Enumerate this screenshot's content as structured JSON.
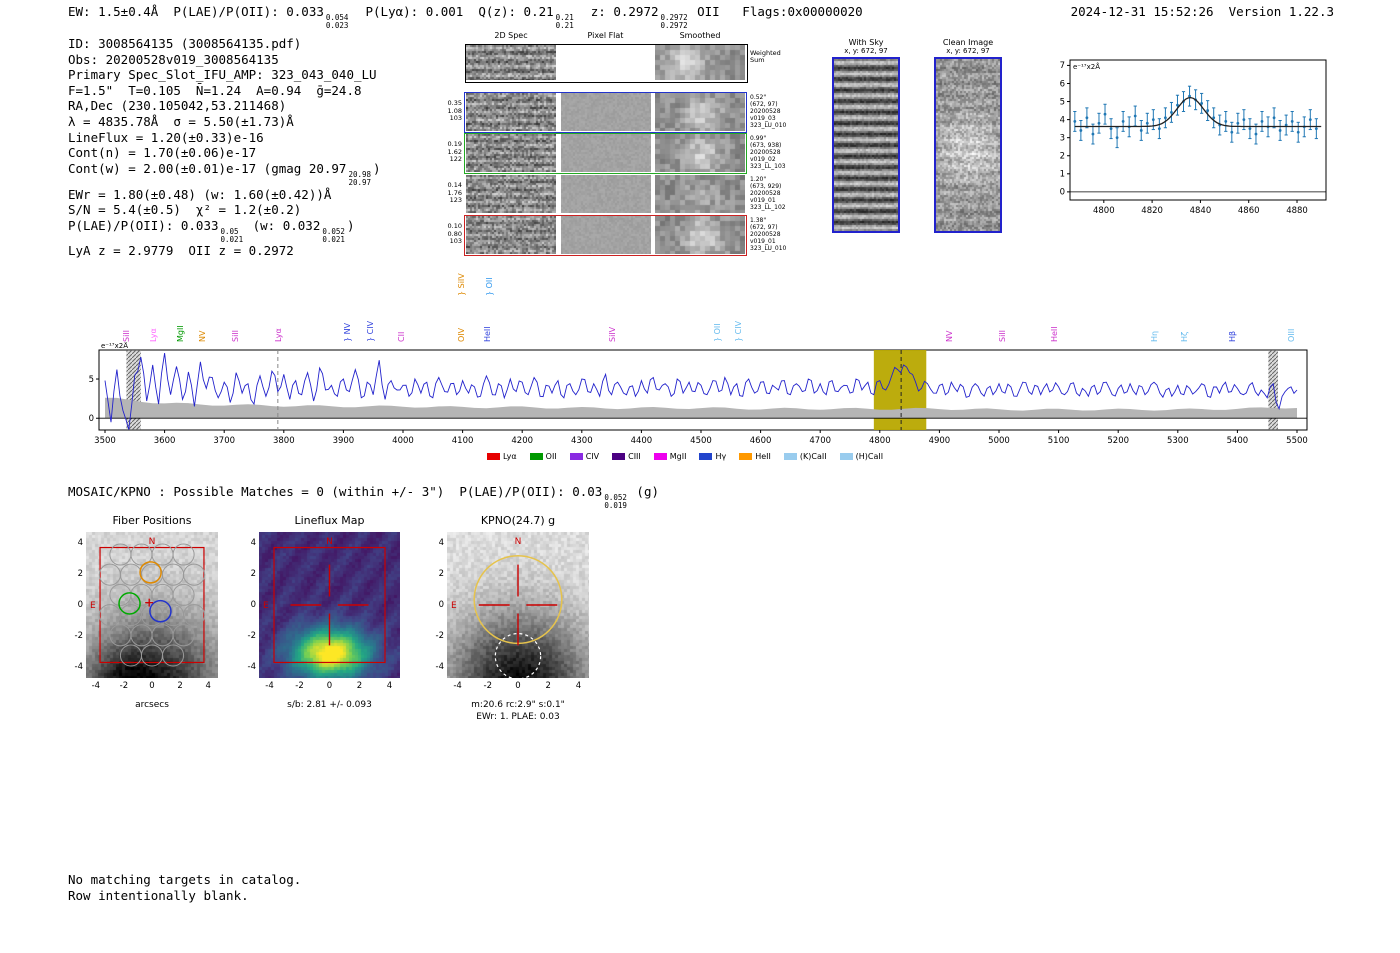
{
  "header": {
    "segments": [
      {
        "t": "EW: 1.5±0.4Å  P(LAE)/P(OII): 0.033"
      },
      {
        "sup": "0.054",
        "sub": "0.023"
      },
      {
        "t": "  P(Lyα): 0.001  Q(z): 0.21"
      },
      {
        "sup": "0.21",
        "sub": "0.21"
      },
      {
        "t": "  z: 0.2972"
      },
      {
        "sup": "0.2972",
        "sub": "0.2972"
      },
      {
        "t": " OII   Flags:0x00000020"
      }
    ],
    "datetime": "2024-12-31 15:52:26",
    "version": "Version 1.22.3"
  },
  "info": {
    "lines": [
      [
        {
          "t": "ID: 3008564135 (3008564135.pdf)"
        }
      ],
      [
        {
          "t": "Obs: 20200528v019_3008564135"
        }
      ],
      [
        {
          "t": "Primary Spec_Slot_IFU_AMP: 323_043_040_LU"
        }
      ],
      [
        {
          "t": "F=1.5\"  T=0.105  N̄=1.24  A=0.94  ḡ=24.8"
        }
      ],
      [
        {
          "t": "RA,Dec (230.105042,53.211468)"
        }
      ],
      [
        {
          "t": "λ = 4835.78Å  σ = 5.50(±1.73)Å"
        }
      ],
      [
        {
          "t": "LineFlux = 1.20(±0.33)e-16"
        }
      ],
      [
        {
          "t": "Cont(n) = 1.70(±0.06)e-17"
        }
      ],
      [
        {
          "t": "Cont(w) = 2.00(±0.01)e-17 (gmag 20.97"
        },
        {
          "sup": "20.98",
          "sub": "20.97"
        },
        {
          "t": ")"
        }
      ],
      [
        {
          "t": "EWr = 1.80(±0.48) (w: 1.60(±0.42))Å"
        }
      ],
      [
        {
          "t": "S/N = 5.4(±0.5)  χ² = 1.2(±0.2)"
        }
      ],
      [
        {
          "t": "P(LAE)/P(OII): 0.033"
        },
        {
          "sup": "0.05",
          "sub": "0.021"
        },
        {
          "t": " (w: 0.032"
        },
        {
          "sup": "0.052",
          "sub": "0.021"
        },
        {
          "t": ")"
        }
      ],
      [
        {
          "t": "LyA z = 2.9779  OII z = 0.2972"
        }
      ]
    ]
  },
  "cutouts": {
    "col_titles": [
      "2D Spec",
      "Pixel Flat",
      "Smoothed"
    ],
    "weighted_label": "Weighted\nSum",
    "rows": [
      {
        "left": "0.35\n1.08\n103",
        "right": "0.52\"\n(672, 97)\n20200528\nv019_03\n323_LU_010",
        "border": "#2233cc"
      },
      {
        "left": "0.19\n1.62\n122",
        "right": "0.99\"\n(673, 938)\n20200528\nv019_02\n323_LL_103",
        "border": "#22aa22"
      },
      {
        "left": "0.14\n1.76\n123",
        "right": "1.20\"\n(673, 929)\n20200528\nv019_01\n323_LL_102",
        "border": null
      },
      {
        "left": "0.10\n0.80\n103",
        "right": "1.38\"\n(672, 97)\n20200528\nv019_01\n323_LU_010",
        "border": "#cc2222"
      }
    ]
  },
  "sky": {
    "with_sky": {
      "title": "With Sky",
      "xy": "x, y: 672, 97"
    },
    "clean": {
      "title": "Clean Image",
      "xy": "x, y: 672, 97"
    }
  },
  "mosaic": {
    "segments": [
      {
        "t": "MOSAIC/KPNO : Possible Matches = 0 (within +/- 3\")  P(LAE)/P(OII): 0.03"
      },
      {
        "sup": "0.052",
        "sub": "0.019"
      },
      {
        "t": " (g)"
      }
    ]
  },
  "panels": {
    "axis_ticks": [
      -4,
      -2,
      0,
      2,
      4
    ],
    "fiber": {
      "title": "Fiber Positions",
      "xlabel": "arcsecs",
      "compass_n": "N",
      "compass_e": "E"
    },
    "lineflux": {
      "title": "Lineflux Map",
      "caption": "s/b: 2.81 +/- 0.093",
      "compass_n": "N",
      "compass_e": "E"
    },
    "kpno": {
      "title": "KPNO(24.7) g",
      "caption": "m:20.6 rc:2.9\" s:0.1\"",
      "caption2": "EWr: 1. PLAE: 0.03",
      "compass_n": "N",
      "compass_e": "E"
    }
  },
  "footer": {
    "lines": [
      "No matching targets in catalog.",
      "Row intentionally blank."
    ]
  },
  "chart_data": [
    {
      "type": "line",
      "name": "emission-line-fit",
      "ylabel": "e⁻¹⁷x2Å",
      "x_start": 4788,
      "x_step": 2.5,
      "y": [
        3.9,
        3.4,
        4.1,
        3.2,
        3.8,
        4.3,
        3.5,
        3.0,
        3.9,
        3.6,
        4.2,
        3.4,
        3.8,
        4.0,
        3.5,
        4.1,
        4.4,
        4.8,
        5.0,
        5.3,
        5.1,
        4.9,
        4.5,
        4.1,
        3.7,
        3.9,
        3.3,
        3.8,
        4.0,
        3.5,
        3.2,
        3.9,
        3.6,
        4.1,
        3.4,
        3.7,
        3.9,
        3.3,
        3.6,
        4.0,
        3.5
      ],
      "yerr": 0.55,
      "fit": {
        "mu": 4835.78,
        "sigma": 5.5,
        "amp": 1.6,
        "continuum": 3.62
      },
      "xlim": [
        4786,
        4892
      ],
      "ylim": [
        -0.45,
        7.3
      ],
      "xticks": [
        4800,
        4820,
        4840,
        4860,
        4880
      ],
      "yticks": [
        0,
        1,
        2,
        3,
        4,
        5,
        6,
        7
      ],
      "point_color": "#1f77b4",
      "fit_color": "#222222"
    },
    {
      "type": "line",
      "name": "full-spectrum",
      "ylabel": "e⁻¹⁷x2Å",
      "x_start": 3500,
      "x_step": 10,
      "y": [
        4.8,
        -0.5,
        6.2,
        1.0,
        -2.2,
        5.5,
        7.8,
        2.2,
        6.8,
        1.8,
        8.3,
        3.0,
        6.6,
        2.4,
        5.9,
        1.5,
        7.2,
        3.8,
        5.2,
        2.6,
        4.6,
        2.0,
        5.8,
        3.2,
        4.4,
        1.8,
        5.4,
        2.8,
        6.0,
        3.4,
        5.6,
        2.4,
        4.8,
        3.0,
        5.8,
        2.2,
        6.4,
        3.6,
        4.2,
        2.8,
        5.0,
        3.4,
        6.2,
        2.6,
        4.6,
        3.0,
        7.4,
        2.4,
        4.8,
        3.6,
        4.2,
        2.8,
        5.0,
        3.2,
        4.6,
        2.6,
        5.2,
        3.4,
        4.4,
        3.0,
        4.8,
        3.2,
        4.0,
        2.8,
        5.4,
        3.0,
        4.4,
        2.6,
        5.0,
        3.4,
        4.6,
        3.0,
        5.2,
        2.8,
        4.2,
        3.2,
        4.8,
        2.6,
        4.4,
        3.0,
        5.0,
        3.4,
        4.4,
        2.8,
        5.6,
        3.0,
        4.6,
        3.2,
        4.0,
        2.8,
        4.8,
        3.2,
        5.2,
        3.6,
        4.4,
        2.8,
        5.0,
        3.2,
        4.6,
        3.4,
        4.2,
        3.0,
        4.8,
        3.4,
        5.2,
        3.0,
        4.4,
        2.8,
        5.0,
        3.2,
        4.6,
        3.2,
        4.2,
        3.6,
        4.8,
        3.0,
        4.4,
        3.4,
        5.0,
        3.2,
        4.4,
        3.0,
        4.8,
        3.4,
        4.2,
        3.2,
        5.0,
        3.6,
        4.6,
        3.0,
        4.8,
        3.6,
        5.4,
        6.2,
        6.8,
        5.8,
        4.6,
        3.8,
        4.4,
        3.2,
        4.2,
        3.0,
        4.6,
        3.4,
        4.0,
        2.8,
        4.4,
        3.2,
        3.8,
        3.0,
        4.4,
        3.2,
        4.0,
        2.8,
        4.6,
        3.4,
        4.2,
        3.0,
        4.4,
        3.6,
        4.0,
        3.0,
        4.4,
        3.2,
        3.8,
        2.8,
        4.2,
        3.4,
        4.6,
        3.0,
        3.8,
        3.2,
        4.4,
        3.0,
        4.0,
        3.4,
        4.6,
        3.2,
        3.6,
        2.8,
        4.2,
        3.0,
        3.8,
        3.4,
        4.4,
        2.8,
        4.0,
        3.2,
        4.6,
        3.4,
        3.8,
        3.0,
        4.2,
        3.4,
        3.6,
        2.6,
        4.4,
        1.2,
        3.4,
        4.0,
        3.6
      ],
      "noise_x_step": 100,
      "noise": [
        2.6,
        1.9,
        1.7,
        1.6,
        1.5,
        1.5,
        1.4,
        1.4,
        1.3,
        1.3,
        1.3,
        1.2,
        1.2,
        1.2,
        1.2,
        1.1,
        1.1,
        1.1,
        1.1,
        1.2,
        1.4
      ],
      "xlim": [
        3500,
        5500
      ],
      "ylim": [
        -1.5,
        8.7
      ],
      "xticks": [
        3500,
        3600,
        3700,
        3800,
        3900,
        4000,
        4100,
        4200,
        4300,
        4400,
        4500,
        4600,
        4700,
        4800,
        4900,
        5000,
        5100,
        5200,
        5300,
        5400,
        5500
      ],
      "yticks": [
        0,
        5
      ],
      "line_color": "#2222cc",
      "noise_color": "#b5b5b5",
      "highlight_band": {
        "x0": 4790,
        "x1": 4878,
        "color": "#b8a800"
      },
      "hatch_bands": [
        {
          "x0": 3536,
          "x1": 3560
        },
        {
          "x0": 5452,
          "x1": 5468
        }
      ],
      "vlines": [
        {
          "x": 3790,
          "color": "#888888"
        },
        {
          "x": 4835.78,
          "color": "#222222"
        }
      ],
      "emission_lines": [
        {
          "label": "SiII",
          "wl": 3539,
          "color": "#cc33cc"
        },
        {
          "label": "Lyα",
          "wl": 3584,
          "color": "#ff66ff"
        },
        {
          "label": "MgII",
          "wl": 3630,
          "color": "#009900"
        },
        {
          "label": "NV",
          "wl": 3666,
          "color": "#dd8800"
        },
        {
          "label": "SiII",
          "wl": 3722,
          "color": "#cc33cc"
        },
        {
          "label": "Lyα",
          "wl": 3794,
          "color": "#cc33cc"
        },
        {
          "label": "NV",
          "wl": 3910,
          "color": "#3344dd",
          "bracket": true
        },
        {
          "label": "CIV",
          "wl": 3948,
          "color": "#3344dd",
          "bracket": true
        },
        {
          "label": "CII",
          "wl": 4000,
          "color": "#cc33cc"
        },
        {
          "label": "OIV",
          "wl": 4100,
          "color": "#dd8800"
        },
        {
          "label": "SiIV",
          "wl": 4100,
          "color": "#dd8800",
          "bracket": true,
          "dy": 46
        },
        {
          "label": "HeII",
          "wl": 4144,
          "color": "#3344dd"
        },
        {
          "label": "OII",
          "wl": 4148,
          "color": "#3399ee",
          "bracket": true,
          "dy": 46
        },
        {
          "label": "SiIV",
          "wl": 4354,
          "color": "#cc33cc"
        },
        {
          "label": "OII",
          "wl": 4530,
          "color": "#66bbee",
          "bracket": true
        },
        {
          "label": "CIV",
          "wl": 4566,
          "color": "#66bbee",
          "bracket": true
        },
        {
          "label": "NV",
          "wl": 4920,
          "color": "#cc33cc"
        },
        {
          "label": "SiII",
          "wl": 5008,
          "color": "#cc33cc"
        },
        {
          "label": "HeII",
          "wl": 5096,
          "color": "#cc33cc"
        },
        {
          "label": "Hη",
          "wl": 5264,
          "color": "#66bbee"
        },
        {
          "label": "Hζ",
          "wl": 5314,
          "color": "#66bbee"
        },
        {
          "label": "Hβ",
          "wl": 5394,
          "color": "#3344dd"
        },
        {
          "label": "OIII",
          "wl": 5494,
          "color": "#66bbee"
        }
      ],
      "legend": [
        {
          "label": "Lyα",
          "color": "#e60000"
        },
        {
          "label": "OII",
          "color": "#009900"
        },
        {
          "label": "CIV",
          "color": "#8a2be2"
        },
        {
          "label": "CIII",
          "color": "#4b0082"
        },
        {
          "label": "MgII",
          "color": "#ee00ee"
        },
        {
          "label": "Hγ",
          "color": "#2244cc"
        },
        {
          "label": "HeII",
          "color": "#ff9900"
        },
        {
          "label": "(K)CaII",
          "color": "#99ccee"
        },
        {
          "label": "(H)CaII",
          "color": "#99ccee"
        }
      ]
    }
  ]
}
